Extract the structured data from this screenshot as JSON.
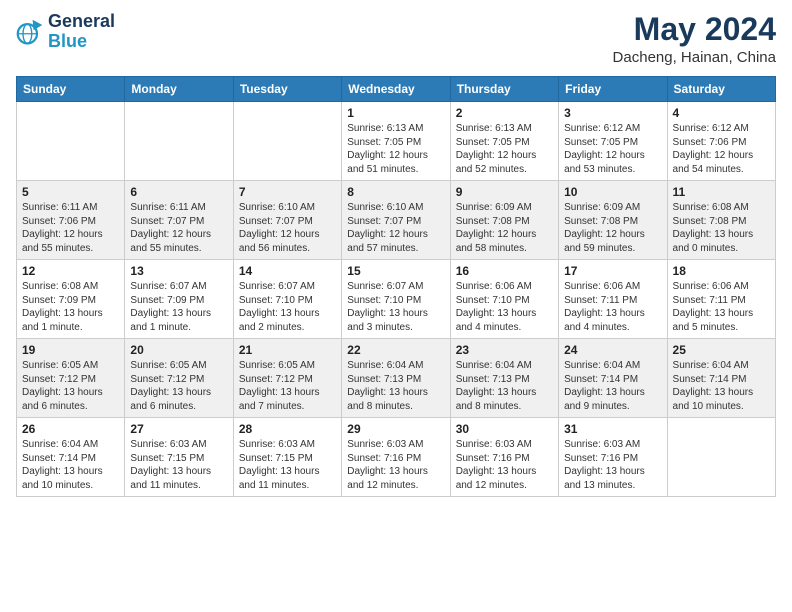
{
  "header": {
    "logo_line1": "General",
    "logo_line2": "Blue",
    "month": "May 2024",
    "location": "Dacheng, Hainan, China"
  },
  "weekdays": [
    "Sunday",
    "Monday",
    "Tuesday",
    "Wednesday",
    "Thursday",
    "Friday",
    "Saturday"
  ],
  "weeks": [
    [
      {
        "day": "",
        "info": ""
      },
      {
        "day": "",
        "info": ""
      },
      {
        "day": "",
        "info": ""
      },
      {
        "day": "1",
        "info": "Sunrise: 6:13 AM\nSunset: 7:05 PM\nDaylight: 12 hours\nand 51 minutes."
      },
      {
        "day": "2",
        "info": "Sunrise: 6:13 AM\nSunset: 7:05 PM\nDaylight: 12 hours\nand 52 minutes."
      },
      {
        "day": "3",
        "info": "Sunrise: 6:12 AM\nSunset: 7:05 PM\nDaylight: 12 hours\nand 53 minutes."
      },
      {
        "day": "4",
        "info": "Sunrise: 6:12 AM\nSunset: 7:06 PM\nDaylight: 12 hours\nand 54 minutes."
      }
    ],
    [
      {
        "day": "5",
        "info": "Sunrise: 6:11 AM\nSunset: 7:06 PM\nDaylight: 12 hours\nand 55 minutes."
      },
      {
        "day": "6",
        "info": "Sunrise: 6:11 AM\nSunset: 7:07 PM\nDaylight: 12 hours\nand 55 minutes."
      },
      {
        "day": "7",
        "info": "Sunrise: 6:10 AM\nSunset: 7:07 PM\nDaylight: 12 hours\nand 56 minutes."
      },
      {
        "day": "8",
        "info": "Sunrise: 6:10 AM\nSunset: 7:07 PM\nDaylight: 12 hours\nand 57 minutes."
      },
      {
        "day": "9",
        "info": "Sunrise: 6:09 AM\nSunset: 7:08 PM\nDaylight: 12 hours\nand 58 minutes."
      },
      {
        "day": "10",
        "info": "Sunrise: 6:09 AM\nSunset: 7:08 PM\nDaylight: 12 hours\nand 59 minutes."
      },
      {
        "day": "11",
        "info": "Sunrise: 6:08 AM\nSunset: 7:08 PM\nDaylight: 13 hours\nand 0 minutes."
      }
    ],
    [
      {
        "day": "12",
        "info": "Sunrise: 6:08 AM\nSunset: 7:09 PM\nDaylight: 13 hours\nand 1 minute."
      },
      {
        "day": "13",
        "info": "Sunrise: 6:07 AM\nSunset: 7:09 PM\nDaylight: 13 hours\nand 1 minute."
      },
      {
        "day": "14",
        "info": "Sunrise: 6:07 AM\nSunset: 7:10 PM\nDaylight: 13 hours\nand 2 minutes."
      },
      {
        "day": "15",
        "info": "Sunrise: 6:07 AM\nSunset: 7:10 PM\nDaylight: 13 hours\nand 3 minutes."
      },
      {
        "day": "16",
        "info": "Sunrise: 6:06 AM\nSunset: 7:10 PM\nDaylight: 13 hours\nand 4 minutes."
      },
      {
        "day": "17",
        "info": "Sunrise: 6:06 AM\nSunset: 7:11 PM\nDaylight: 13 hours\nand 4 minutes."
      },
      {
        "day": "18",
        "info": "Sunrise: 6:06 AM\nSunset: 7:11 PM\nDaylight: 13 hours\nand 5 minutes."
      }
    ],
    [
      {
        "day": "19",
        "info": "Sunrise: 6:05 AM\nSunset: 7:12 PM\nDaylight: 13 hours\nand 6 minutes."
      },
      {
        "day": "20",
        "info": "Sunrise: 6:05 AM\nSunset: 7:12 PM\nDaylight: 13 hours\nand 6 minutes."
      },
      {
        "day": "21",
        "info": "Sunrise: 6:05 AM\nSunset: 7:12 PM\nDaylight: 13 hours\nand 7 minutes."
      },
      {
        "day": "22",
        "info": "Sunrise: 6:04 AM\nSunset: 7:13 PM\nDaylight: 13 hours\nand 8 minutes."
      },
      {
        "day": "23",
        "info": "Sunrise: 6:04 AM\nSunset: 7:13 PM\nDaylight: 13 hours\nand 8 minutes."
      },
      {
        "day": "24",
        "info": "Sunrise: 6:04 AM\nSunset: 7:14 PM\nDaylight: 13 hours\nand 9 minutes."
      },
      {
        "day": "25",
        "info": "Sunrise: 6:04 AM\nSunset: 7:14 PM\nDaylight: 13 hours\nand 10 minutes."
      }
    ],
    [
      {
        "day": "26",
        "info": "Sunrise: 6:04 AM\nSunset: 7:14 PM\nDaylight: 13 hours\nand 10 minutes."
      },
      {
        "day": "27",
        "info": "Sunrise: 6:03 AM\nSunset: 7:15 PM\nDaylight: 13 hours\nand 11 minutes."
      },
      {
        "day": "28",
        "info": "Sunrise: 6:03 AM\nSunset: 7:15 PM\nDaylight: 13 hours\nand 11 minutes."
      },
      {
        "day": "29",
        "info": "Sunrise: 6:03 AM\nSunset: 7:16 PM\nDaylight: 13 hours\nand 12 minutes."
      },
      {
        "day": "30",
        "info": "Sunrise: 6:03 AM\nSunset: 7:16 PM\nDaylight: 13 hours\nand 12 minutes."
      },
      {
        "day": "31",
        "info": "Sunrise: 6:03 AM\nSunset: 7:16 PM\nDaylight: 13 hours\nand 13 minutes."
      },
      {
        "day": "",
        "info": ""
      }
    ]
  ]
}
